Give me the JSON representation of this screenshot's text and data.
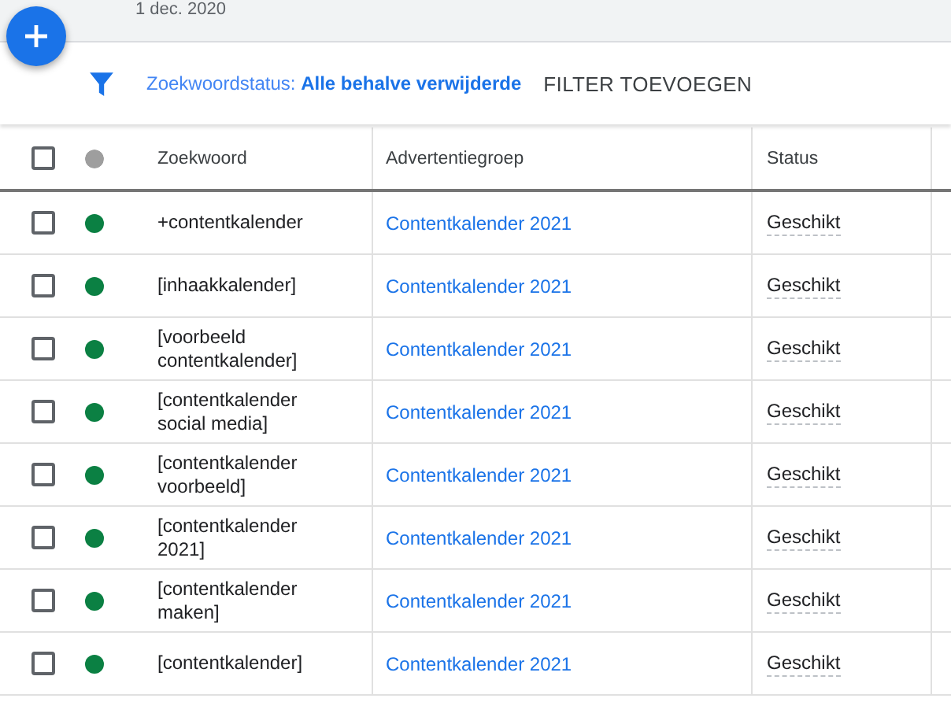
{
  "header": {
    "date": "1 dec. 2020"
  },
  "filter": {
    "label": "Zoekwoordstatus:",
    "value": "Alle behalve verwijderde",
    "add_button": "FILTER TOEVOEGEN"
  },
  "table": {
    "select_all": {
      "checked": false
    },
    "columns": [
      "Zoekwoord",
      "Advertentiegroep",
      "Status"
    ],
    "rows": [
      {
        "checked": false,
        "color": "#0b8043",
        "keyword": "+contentkalender",
        "ad_group": "Contentkalender 2021",
        "status": "Geschikt"
      },
      {
        "checked": false,
        "color": "#0b8043",
        "keyword": "[inhaakkalender]",
        "ad_group": "Contentkalender 2021",
        "status": "Geschikt"
      },
      {
        "checked": false,
        "color": "#0b8043",
        "keyword": "[voorbeeld contentkalender]",
        "ad_group": "Contentkalender 2021",
        "status": "Geschikt"
      },
      {
        "checked": false,
        "color": "#0b8043",
        "keyword": "[contentkalender social media]",
        "ad_group": "Contentkalender 2021",
        "status": "Geschikt"
      },
      {
        "checked": false,
        "color": "#0b8043",
        "keyword": "[contentkalender voorbeeld]",
        "ad_group": "Contentkalender 2021",
        "status": "Geschikt"
      },
      {
        "checked": false,
        "color": "#0b8043",
        "keyword": "[contentkalender 2021]",
        "ad_group": "Contentkalender 2021",
        "status": "Geschikt"
      },
      {
        "checked": false,
        "color": "#0b8043",
        "keyword": "[contentkalender maken]",
        "ad_group": "Contentkalender 2021",
        "status": "Geschikt"
      },
      {
        "checked": false,
        "color": "#0b8043",
        "keyword": "[contentkalender]",
        "ad_group": "Contentkalender 2021",
        "status": "Geschikt"
      }
    ]
  }
}
